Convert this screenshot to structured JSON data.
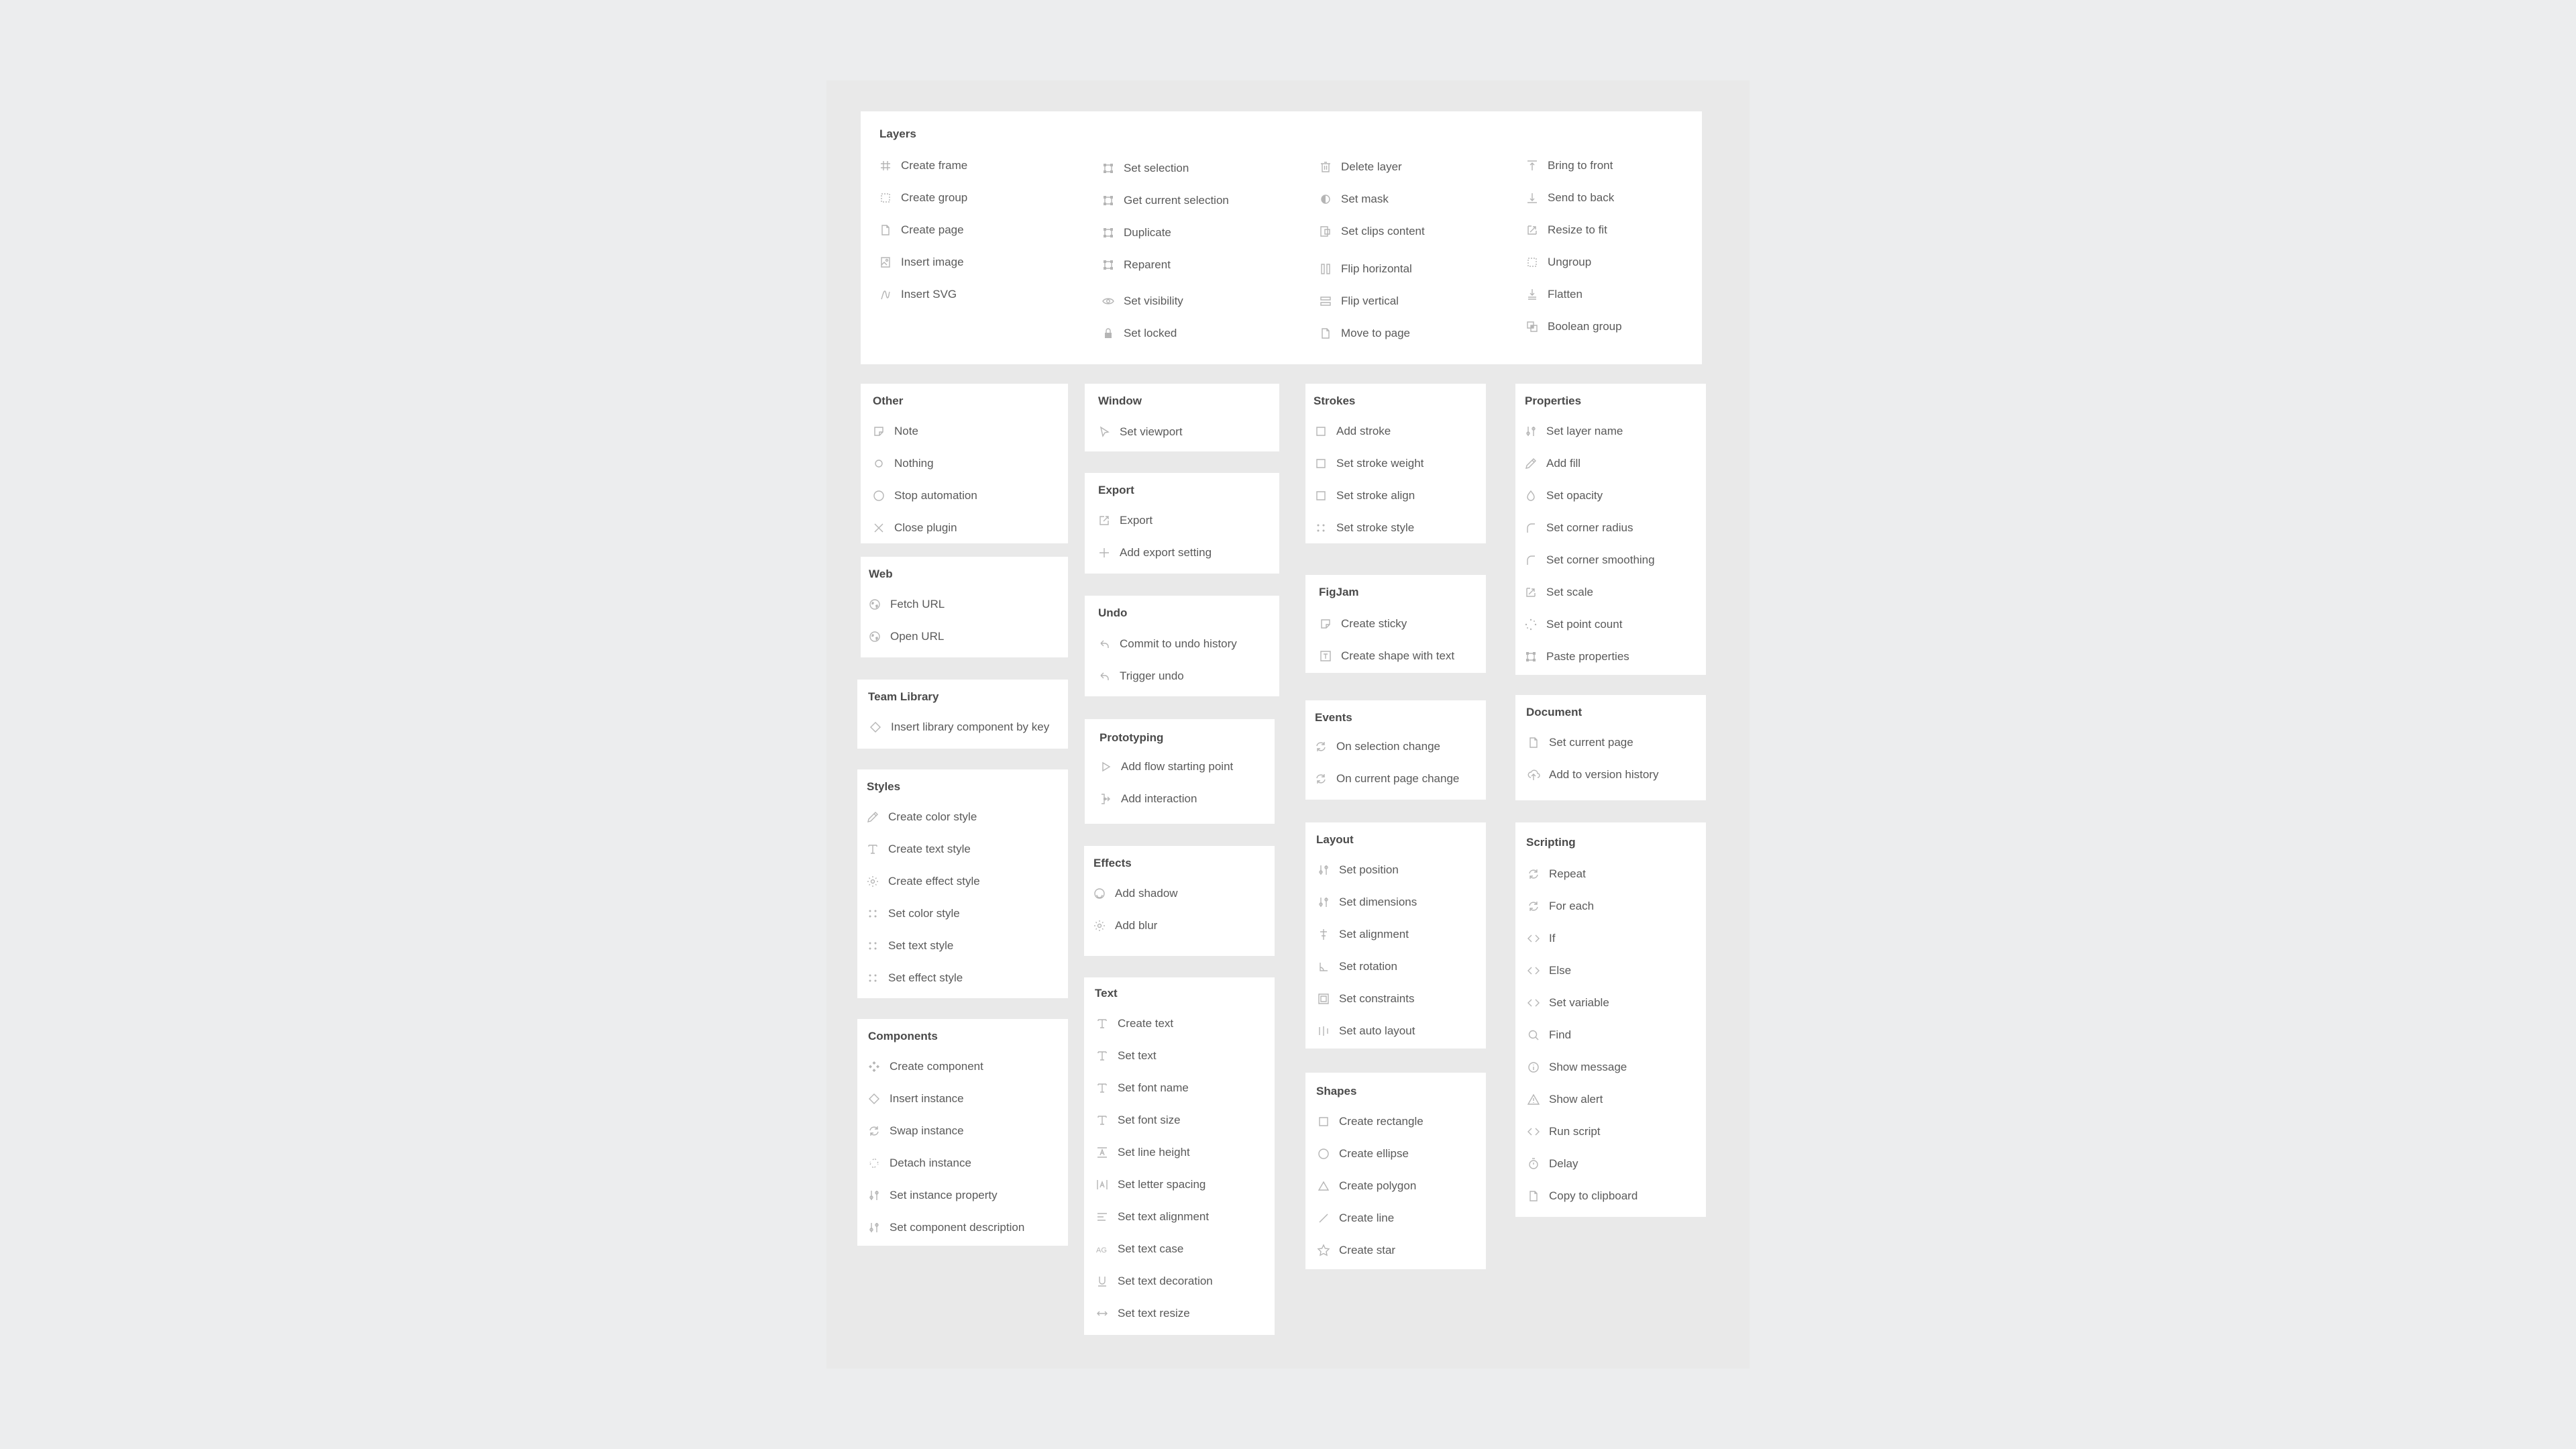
{
  "colors": {
    "page_background": "#ecedee",
    "canvas_background": "#e9e9e9",
    "panel_background": "#ffffff",
    "title_text": "#4a4a4a",
    "item_text": "#5a5a5a",
    "icon": "#b5b5b5"
  },
  "panels": {
    "layers": {
      "title": "Layers",
      "columns": [
        [
          {
            "label": "Create frame",
            "icon": "hash-frame-icon"
          },
          {
            "label": "Create group",
            "icon": "dashed-square-icon"
          },
          {
            "label": "Create page",
            "icon": "page-icon"
          },
          {
            "label": "Insert image",
            "icon": "image-icon"
          },
          {
            "label": "Insert SVG",
            "icon": "pen-path-icon"
          }
        ],
        [
          {
            "label": "Set selection",
            "icon": "selection-box-icon"
          },
          {
            "label": "Get current selection",
            "icon": "selection-box-icon"
          },
          {
            "label": "Duplicate",
            "icon": "selection-box-icon"
          },
          {
            "label": "Reparent",
            "icon": "selection-box-icon"
          },
          {
            "label": "Set visibility",
            "icon": "eye-icon"
          },
          {
            "label": "Set locked",
            "icon": "lock-icon"
          }
        ],
        [
          {
            "label": "Delete layer",
            "icon": "trash-icon"
          },
          {
            "label": "Set mask",
            "icon": "mask-icon"
          },
          {
            "label": "Set clips content",
            "icon": "clip-content-icon"
          },
          {
            "label": "Flip horizontal",
            "icon": "flip-horizontal-icon"
          },
          {
            "label": "Flip vertical",
            "icon": "flip-vertical-icon"
          },
          {
            "label": "Move to page",
            "icon": "page-icon"
          }
        ],
        [
          {
            "label": "Bring to front",
            "icon": "bring-to-front-icon"
          },
          {
            "label": "Send to back",
            "icon": "send-to-back-icon"
          },
          {
            "label": "Resize to fit",
            "icon": "resize-icon"
          },
          {
            "label": "Ungroup",
            "icon": "dashed-square-icon"
          },
          {
            "label": "Flatten",
            "icon": "flatten-icon"
          },
          {
            "label": "Boolean group",
            "icon": "boolean-group-icon"
          }
        ]
      ]
    },
    "other": {
      "title": "Other",
      "items": [
        {
          "label": "Note",
          "icon": "note-icon"
        },
        {
          "label": "Nothing",
          "icon": "circle-small-icon"
        },
        {
          "label": "Stop automation",
          "icon": "circle-icon"
        },
        {
          "label": "Close plugin",
          "icon": "close-icon"
        }
      ]
    },
    "web": {
      "title": "Web",
      "items": [
        {
          "label": "Fetch URL",
          "icon": "globe-icon"
        },
        {
          "label": "Open URL",
          "icon": "globe-icon"
        }
      ]
    },
    "team_library": {
      "title": "Team Library",
      "items": [
        {
          "label": "Insert library component by key",
          "icon": "diamond-icon"
        }
      ]
    },
    "styles": {
      "title": "Styles",
      "items": [
        {
          "label": "Create color style",
          "icon": "eyedropper-icon"
        },
        {
          "label": "Create text style",
          "icon": "type-icon"
        },
        {
          "label": "Create effect style",
          "icon": "sun-icon"
        },
        {
          "label": "Set color style",
          "icon": "four-dots-icon"
        },
        {
          "label": "Set text style",
          "icon": "four-dots-icon"
        },
        {
          "label": "Set effect style",
          "icon": "four-dots-icon"
        }
      ]
    },
    "components": {
      "title": "Components",
      "items": [
        {
          "label": "Create component",
          "icon": "component-icon"
        },
        {
          "label": "Insert instance",
          "icon": "diamond-icon"
        },
        {
          "label": "Swap instance",
          "icon": "swap-icon"
        },
        {
          "label": "Detach instance",
          "icon": "detach-icon"
        },
        {
          "label": "Set instance property",
          "icon": "sliders-icon"
        },
        {
          "label": "Set component description",
          "icon": "sliders-icon"
        }
      ]
    },
    "window": {
      "title": "Window",
      "items": [
        {
          "label": "Set viewport",
          "icon": "cursor-icon"
        }
      ]
    },
    "export": {
      "title": "Export",
      "items": [
        {
          "label": "Export",
          "icon": "export-icon"
        },
        {
          "label": "Add export setting",
          "icon": "plus-icon"
        }
      ]
    },
    "undo": {
      "title": "Undo",
      "items": [
        {
          "label": "Commit to undo history",
          "icon": "undo-icon"
        },
        {
          "label": "Trigger undo",
          "icon": "undo-icon"
        }
      ]
    },
    "prototyping": {
      "title": "Prototyping",
      "items": [
        {
          "label": "Add flow starting point",
          "icon": "play-icon"
        },
        {
          "label": "Add interaction",
          "icon": "interaction-icon"
        }
      ]
    },
    "effects": {
      "title": "Effects",
      "items": [
        {
          "label": "Add shadow",
          "icon": "shadow-icon"
        },
        {
          "label": "Add blur",
          "icon": "sun-icon"
        }
      ]
    },
    "text": {
      "title": "Text",
      "items": [
        {
          "label": "Create text",
          "icon": "type-icon"
        },
        {
          "label": "Set text",
          "icon": "type-icon"
        },
        {
          "label": "Set font name",
          "icon": "type-icon"
        },
        {
          "label": "Set font size",
          "icon": "type-icon"
        },
        {
          "label": "Set line height",
          "icon": "line-height-icon"
        },
        {
          "label": "Set letter spacing",
          "icon": "letter-spacing-icon"
        },
        {
          "label": "Set text alignment",
          "icon": "align-left-icon"
        },
        {
          "label": "Set text case",
          "icon": "text-case-icon"
        },
        {
          "label": "Set text decoration",
          "icon": "underline-icon"
        },
        {
          "label": "Set text resize",
          "icon": "resize-horizontal-icon"
        }
      ]
    },
    "strokes": {
      "title": "Strokes",
      "items": [
        {
          "label": "Add stroke",
          "icon": "square-icon"
        },
        {
          "label": "Set stroke weight",
          "icon": "square-icon"
        },
        {
          "label": "Set stroke align",
          "icon": "square-icon"
        },
        {
          "label": "Set stroke style",
          "icon": "four-dots-icon"
        }
      ]
    },
    "figjam": {
      "title": "FigJam",
      "items": [
        {
          "label": "Create sticky",
          "icon": "sticky-icon"
        },
        {
          "label": "Create shape with text",
          "icon": "shape-text-icon"
        }
      ]
    },
    "events": {
      "title": "Events",
      "items": [
        {
          "label": "On selection change",
          "icon": "refresh-icon"
        },
        {
          "label": "On current page change",
          "icon": "refresh-icon"
        }
      ]
    },
    "layout": {
      "title": "Layout",
      "items": [
        {
          "label": "Set position",
          "icon": "sliders-icon"
        },
        {
          "label": "Set dimensions",
          "icon": "sliders-icon"
        },
        {
          "label": "Set alignment",
          "icon": "align-center-icon"
        },
        {
          "label": "Set rotation",
          "icon": "angle-icon"
        },
        {
          "label": "Set constraints",
          "icon": "constraints-icon"
        },
        {
          "label": "Set auto layout",
          "icon": "auto-layout-icon"
        }
      ]
    },
    "shapes": {
      "title": "Shapes",
      "items": [
        {
          "label": "Create rectangle",
          "icon": "square-icon"
        },
        {
          "label": "Create ellipse",
          "icon": "circle-icon"
        },
        {
          "label": "Create polygon",
          "icon": "triangle-icon"
        },
        {
          "label": "Create line",
          "icon": "line-icon"
        },
        {
          "label": "Create star",
          "icon": "star-icon"
        }
      ]
    },
    "properties": {
      "title": "Properties",
      "items": [
        {
          "label": "Set layer name",
          "icon": "sliders-icon"
        },
        {
          "label": "Add fill",
          "icon": "eyedropper-icon"
        },
        {
          "label": "Set opacity",
          "icon": "drop-icon"
        },
        {
          "label": "Set corner radius",
          "icon": "corner-radius-icon"
        },
        {
          "label": "Set corner smoothing",
          "icon": "corner-radius-icon"
        },
        {
          "label": "Set scale",
          "icon": "resize-icon"
        },
        {
          "label": "Set point count",
          "icon": "points-icon"
        },
        {
          "label": "Paste properties",
          "icon": "selection-box-icon"
        }
      ]
    },
    "document": {
      "title": "Document",
      "items": [
        {
          "label": "Set current page",
          "icon": "page-icon"
        },
        {
          "label": "Add to version history",
          "icon": "cloud-upload-icon"
        }
      ]
    },
    "scripting": {
      "title": "Scripting",
      "items": [
        {
          "label": "Repeat",
          "icon": "refresh-icon"
        },
        {
          "label": "For each",
          "icon": "refresh-icon"
        },
        {
          "label": "If",
          "icon": "code-icon"
        },
        {
          "label": "Else",
          "icon": "code-icon"
        },
        {
          "label": "Set variable",
          "icon": "code-icon"
        },
        {
          "label": "Find",
          "icon": "search-icon"
        },
        {
          "label": "Show message",
          "icon": "info-icon"
        },
        {
          "label": "Show alert",
          "icon": "warning-icon"
        },
        {
          "label": "Run script",
          "icon": "code-icon"
        },
        {
          "label": "Delay",
          "icon": "timer-icon"
        },
        {
          "label": "Copy to clipboard",
          "icon": "page-icon"
        }
      ]
    }
  }
}
